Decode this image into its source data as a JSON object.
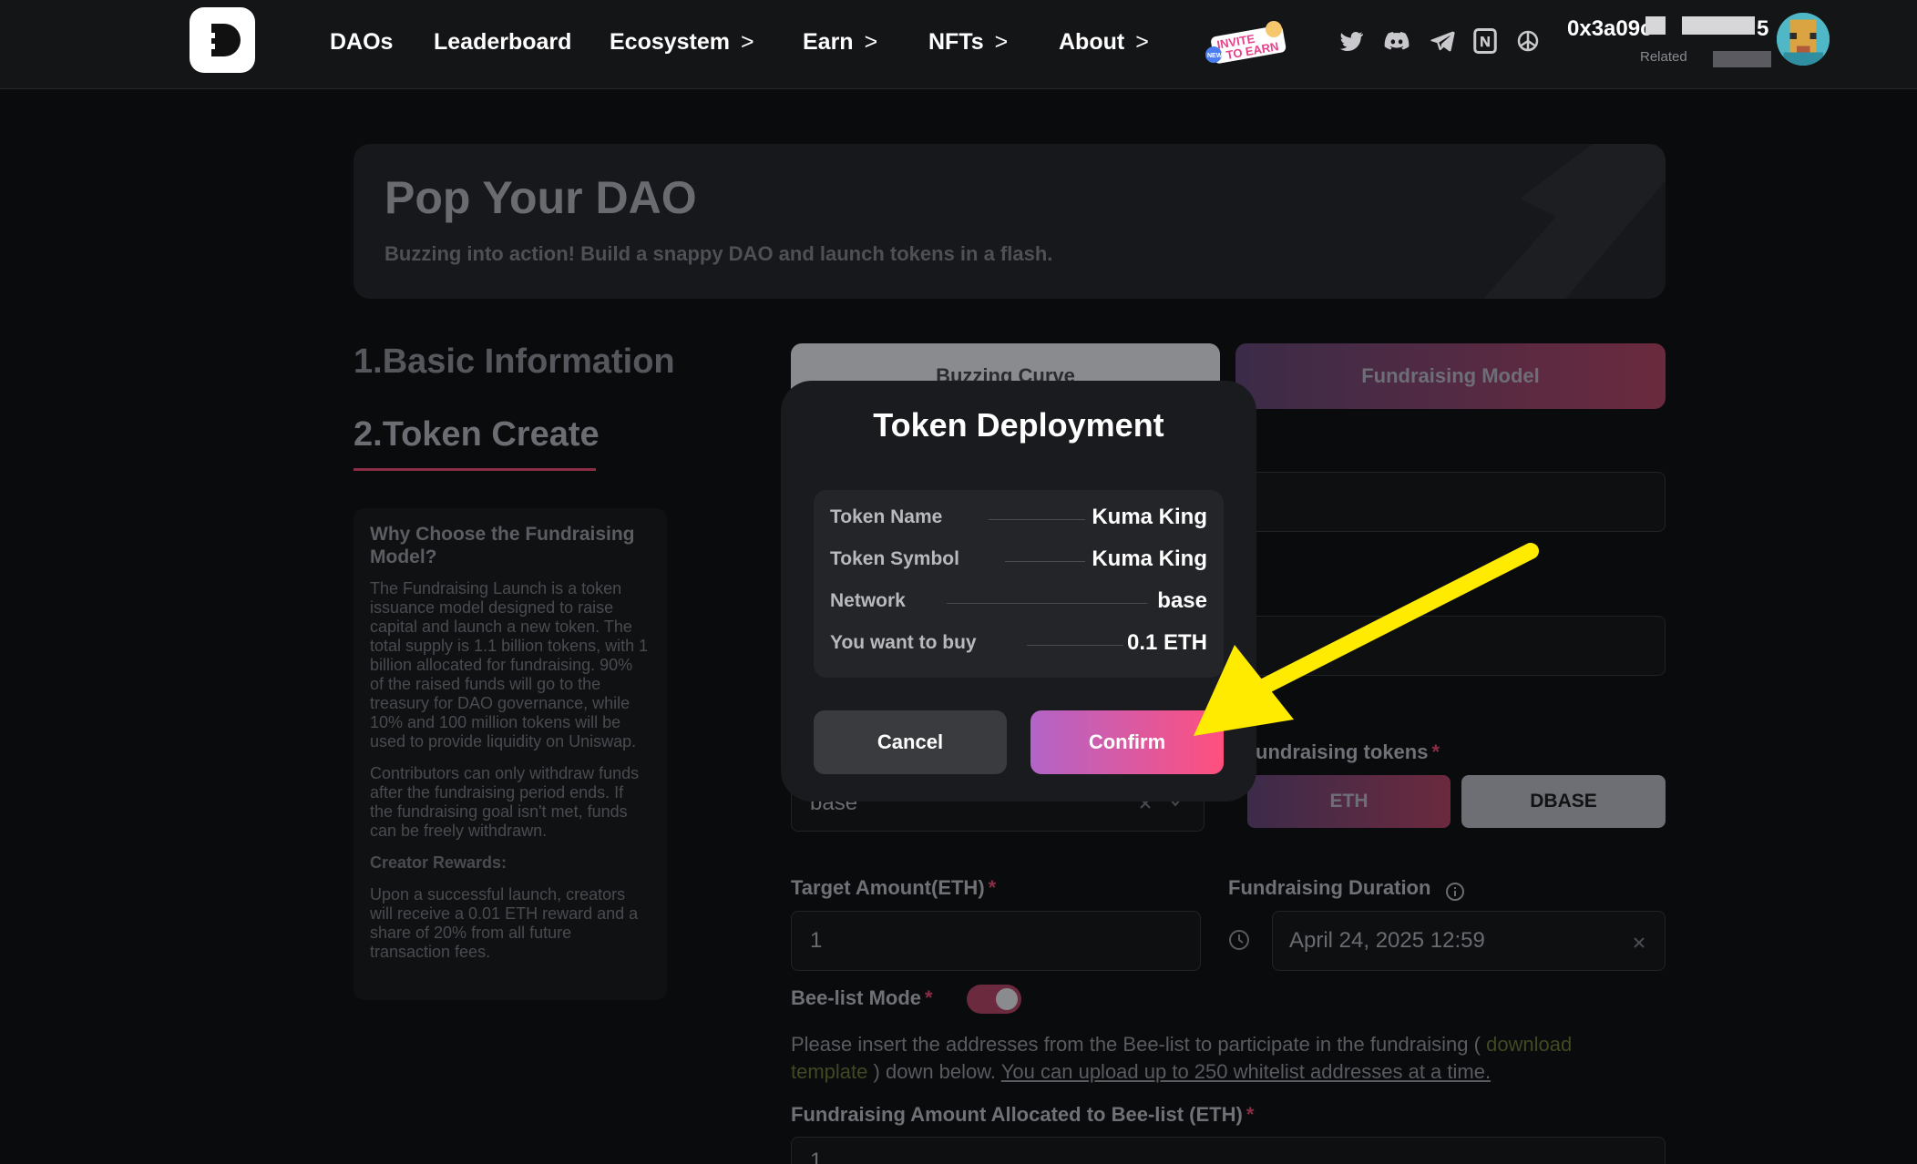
{
  "nav": {
    "items": [
      {
        "label": "DAOs",
        "has_chevron": false
      },
      {
        "label": "Leaderboard",
        "has_chevron": false
      },
      {
        "label": "Ecosystem",
        "has_chevron": true
      },
      {
        "label": "Earn",
        "has_chevron": true
      },
      {
        "label": "NFTs",
        "has_chevron": true
      },
      {
        "label": "About",
        "has_chevron": true
      }
    ],
    "chevron": ">",
    "invite_badge": {
      "line1": "INVITE",
      "line2": "TO EARN",
      "tag": "NEW"
    },
    "social_icons": [
      "twitter-icon",
      "discord-icon",
      "telegram-icon",
      "notion-icon",
      "chatgpt-icon"
    ],
    "wallet": {
      "address": "0x3a09c",
      "suffix": "5",
      "sub_label": "Related"
    }
  },
  "hero": {
    "title": "Pop Your DAO",
    "subtitle": "Buzzing into action! Build a snappy DAO and launch tokens in a flash."
  },
  "steps": {
    "step1": "1.Basic Information",
    "step2": "2.Token Create"
  },
  "info": {
    "heading": "Why Choose the Fundraising Model?",
    "p1": "The Fundraising Launch is a token issuance model designed to raise capital and launch a new token. The total supply is 1.1 billion tokens, with 1 billion allocated for fundraising. 90% of the raised funds will go to the treasury for DAO governance, while 10% and 100 million tokens will be used to provide liquidity on Uniswap.",
    "p2": "Contributors can only withdraw funds after the fundraising period ends. If the fundraising goal isn't met, funds can be freely withdrawn.",
    "creator_heading": "Creator Rewards:",
    "p3": "Upon a successful launch, creators will receive a 0.01 ETH reward and a share of 20% from all future transaction fees."
  },
  "tabs": {
    "curve": "Buzzing Curve",
    "fundraising": "Fundraising Model"
  },
  "form": {
    "network_value": "base",
    "fundraising_tokens_label": "undraising tokens",
    "token_eth": "ETH",
    "token_dbase": "DBASE",
    "target_label": "Target Amount(ETH)",
    "target_value": "1",
    "duration_label": "Fundraising Duration",
    "duration_value": "April 24, 2025 12:59",
    "beelist_label": "Bee-list Mode",
    "beelist_on": true,
    "hint_prefix": "Please insert the addresses from the Bee-list to participate in the fundraising (",
    "hint_link": "download template",
    "hint_middle": ") down below.",
    "hint_underline": "You can upload up to 250 whitelist addresses at a time.",
    "allocated_label": "Fundraising Amount Allocated to Bee-list (ETH)",
    "allocated_value": "1",
    "required_mark": "*"
  },
  "modal": {
    "title": "Token Deployment",
    "rows": [
      {
        "label": "Token Name",
        "value": "Kuma King"
      },
      {
        "label": "Token Symbol",
        "value": "Kuma King"
      },
      {
        "label": "Network",
        "value": "base"
      },
      {
        "label": "You want to buy",
        "value": "0.1 ETH"
      }
    ],
    "cancel": "Cancel",
    "confirm": "Confirm"
  },
  "colors": {
    "accent_pink": "#ff4f7e",
    "accent_purple": "#b264c8",
    "annotation_arrow": "#ffeb00"
  }
}
